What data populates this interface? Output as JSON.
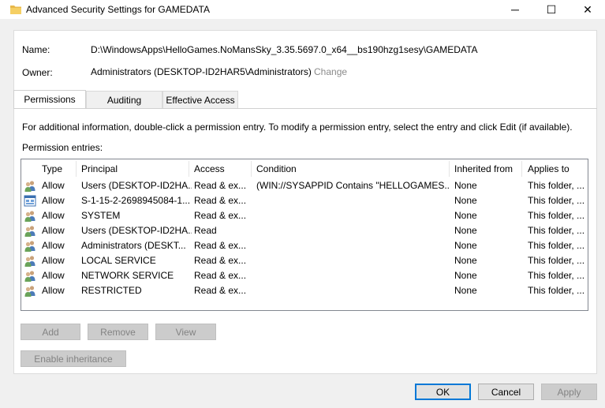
{
  "window": {
    "title": "Advanced Security Settings for GAMEDATA",
    "minimize": "─",
    "maximize": "☐",
    "close": "✕"
  },
  "info": {
    "name_label": "Name:",
    "name_value": "D:\\WindowsApps\\HelloGames.NoMansSky_3.35.5697.0_x64__bs190hzg1sesy\\GAMEDATA",
    "owner_label": "Owner:",
    "owner_value": "Administrators (DESKTOP-ID2HAR5\\Administrators)",
    "change_link": "Change"
  },
  "tabs": [
    {
      "label": "Permissions",
      "active": true
    },
    {
      "label": "Auditing",
      "active": false
    },
    {
      "label": "Effective Access",
      "active": false
    }
  ],
  "instructions": "For additional information, double-click a permission entry. To modify a permission entry, select the entry and click Edit (if available).",
  "entries_label": "Permission entries:",
  "columns": [
    "Type",
    "Principal",
    "Access",
    "Condition",
    "Inherited from",
    "Applies to"
  ],
  "rows": [
    {
      "icon": "users",
      "type": "Allow",
      "principal": "Users (DESKTOP-ID2HA...",
      "access": "Read & ex...",
      "condition": "(WIN://SYSAPPID Contains \"HELLOGAMES....",
      "inherited": "None",
      "applies": "This folder, ..."
    },
    {
      "icon": "app",
      "type": "Allow",
      "principal": "S-1-15-2-2698945084-1...",
      "access": "Read & ex...",
      "condition": "",
      "inherited": "None",
      "applies": "This folder, ..."
    },
    {
      "icon": "users",
      "type": "Allow",
      "principal": "SYSTEM",
      "access": "Read & ex...",
      "condition": "",
      "inherited": "None",
      "applies": "This folder, ..."
    },
    {
      "icon": "users",
      "type": "Allow",
      "principal": "Users (DESKTOP-ID2HA...",
      "access": "Read",
      "condition": "",
      "inherited": "None",
      "applies": "This folder, ..."
    },
    {
      "icon": "users",
      "type": "Allow",
      "principal": "Administrators (DESKT...",
      "access": "Read & ex...",
      "condition": "",
      "inherited": "None",
      "applies": "This folder, ..."
    },
    {
      "icon": "users",
      "type": "Allow",
      "principal": "LOCAL SERVICE",
      "access": "Read & ex...",
      "condition": "",
      "inherited": "None",
      "applies": "This folder, ..."
    },
    {
      "icon": "users",
      "type": "Allow",
      "principal": "NETWORK SERVICE",
      "access": "Read & ex...",
      "condition": "",
      "inherited": "None",
      "applies": "This folder, ..."
    },
    {
      "icon": "users",
      "type": "Allow",
      "principal": "RESTRICTED",
      "access": "Read & ex...",
      "condition": "",
      "inherited": "None",
      "applies": "This folder, ..."
    }
  ],
  "buttons": {
    "add": "Add",
    "remove": "Remove",
    "view": "View",
    "enable_inheritance": "Enable inheritance",
    "ok": "OK",
    "cancel": "Cancel",
    "apply": "Apply"
  }
}
